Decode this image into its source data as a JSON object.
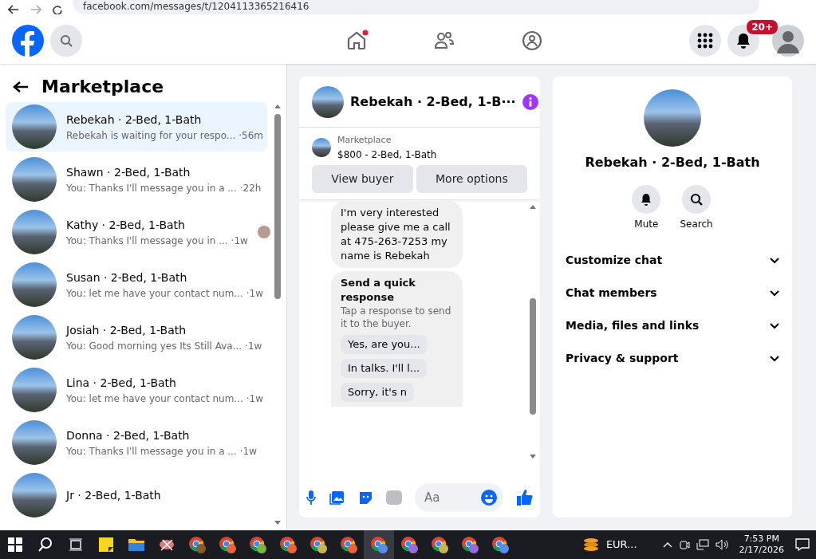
{
  "browser": {
    "url": "facebook.com/messages/t/1204113365216416"
  },
  "header": {
    "nav": [
      {
        "kind": "home",
        "selected": false,
        "dot": true
      },
      {
        "kind": "friends",
        "selected": false,
        "dot": false
      },
      {
        "kind": "groups",
        "selected": false,
        "dot": false
      }
    ],
    "notifications_badge": "20+"
  },
  "sidebar": {
    "title": "Marketplace",
    "items": [
      {
        "name": "Rebekah · 2-Bed, 1-Bath",
        "preview": "Rebekah is waiting for your respo...",
        "time": "·56m",
        "selected": true,
        "seen_avatar": false
      },
      {
        "name": "Shawn · 2-Bed, 1-Bath",
        "preview": "You: Thanks I'll message you in a ...",
        "time": "·22h",
        "selected": false,
        "seen_avatar": false
      },
      {
        "name": "Kathy · 2-Bed, 1-Bath",
        "preview": "You: Thanks I'll message you in ...",
        "time": "·1w",
        "selected": false,
        "seen_avatar": true
      },
      {
        "name": "Susan · 2-Bed, 1-Bath",
        "preview": "You: let me have your contact num...",
        "time": "·1w",
        "selected": false,
        "seen_avatar": false
      },
      {
        "name": "Josiah · 2-Bed, 1-Bath",
        "preview": "You: Good morning yes Its Still Ava...",
        "time": "·1w",
        "selected": false,
        "seen_avatar": false
      },
      {
        "name": "Lina · 2-Bed, 1-Bath",
        "preview": "You: let me have your contact num...",
        "time": "·1w",
        "selected": false,
        "seen_avatar": false
      },
      {
        "name": "Donna · 2-Bed, 1-Bath",
        "preview": "You: Thanks I'll message you in a ...",
        "time": "·1w",
        "selected": false,
        "seen_avatar": false
      },
      {
        "name": "Jr · 2-Bed, 1-Bath",
        "selected": false,
        "seen_avatar": false
      }
    ]
  },
  "chat": {
    "title": "Rebekah · 2-Bed, 1-B···",
    "listing": {
      "label": "Marketplace",
      "price_title": "$800 - 2-Bed, 1-Bath"
    },
    "buttons": [
      "View buyer",
      "More options"
    ],
    "messages": [
      {
        "kind": "text",
        "text": "I'm very interested please give me a call at 475-263-7253 my name is Rebekah"
      },
      {
        "kind": "quick",
        "title": "Send a quick response",
        "subtitle": "Tap a response to send it to the buyer.",
        "options": [
          "Yes, are you...",
          "In talks. I'll l...",
          "Sorry, it's n"
        ]
      }
    ],
    "composer": {
      "placeholder": "Aa"
    }
  },
  "details": {
    "name": "Rebekah · 2-Bed, 1-Bath",
    "actions": [
      {
        "kind": "mute",
        "label": "Mute"
      },
      {
        "kind": "search",
        "label": "Search"
      }
    ],
    "sections": [
      {
        "label": "Customize chat",
        "expanded": false
      },
      {
        "label": "Chat members",
        "expanded": false
      },
      {
        "label": "Media, files and links",
        "expanded": false
      },
      {
        "label": "Privacy & support",
        "expanded": false
      }
    ]
  },
  "taskbar": {
    "apps": [
      {
        "kind": "notes"
      },
      {
        "kind": "folder"
      },
      {
        "kind": "snip"
      },
      {
        "kind": "chrome",
        "color": "#8b5a2b",
        "selected": false
      },
      {
        "kind": "chrome",
        "color": "#e8643c",
        "selected": false
      },
      {
        "kind": "chrome",
        "color": "#7cb342",
        "selected": false
      },
      {
        "kind": "chrome",
        "color": "#e8643c",
        "selected": false
      },
      {
        "kind": "chrome",
        "color": "#c9b458",
        "selected": false
      },
      {
        "kind": "chrome",
        "color": "#e8643c",
        "selected": false
      },
      {
        "kind": "chrome",
        "color": "#5b8def",
        "selected": true
      },
      {
        "kind": "chrome",
        "color": "#9c6ade",
        "selected": false
      },
      {
        "kind": "chrome",
        "color": "#c9b458",
        "selected": false
      },
      {
        "kind": "chrome",
        "color": "#9c6ade",
        "selected": false
      },
      {
        "kind": "chrome",
        "color": "#5b8def",
        "selected": false
      }
    ],
    "widget": "EUR...",
    "time": "7:53 PM",
    "date": "2/17/2026"
  }
}
